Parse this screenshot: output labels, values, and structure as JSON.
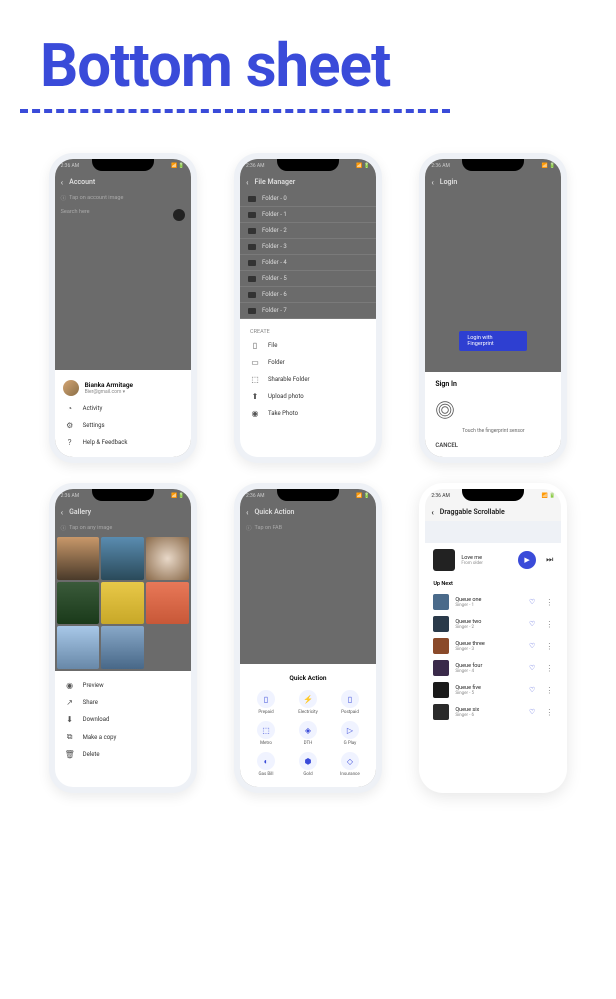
{
  "page": {
    "title": "Bottom sheet"
  },
  "status": {
    "time": "2:36 AM"
  },
  "p1": {
    "title": "Account",
    "hint": "Tap on account image",
    "search": "Search here",
    "user": {
      "name": "Bianka Armitage",
      "email": "Bier@gmail.com ▾"
    },
    "items": [
      "Activity",
      "Settings",
      "Help & Feedback"
    ]
  },
  "p2": {
    "title": "File Manager",
    "folders": [
      "Folder - 0",
      "Folder - 1",
      "Folder - 2",
      "Folder - 3",
      "Folder - 4",
      "Folder - 5",
      "Folder - 6",
      "Folder - 7"
    ],
    "create": "CREATE",
    "items": [
      "File",
      "Folder",
      "Sharable Folder",
      "Upload photo",
      "Take Photo"
    ]
  },
  "p3": {
    "title": "Login",
    "btn": "Login with Fingerprint",
    "signin": "Sign In",
    "touch": "Touch the fingerprint sensor",
    "cancel": "CANCEL"
  },
  "p4": {
    "title": "Gallery",
    "hint": "Tap on any image",
    "items": [
      "Preview",
      "Share",
      "Download",
      "Make a copy",
      "Delete"
    ]
  },
  "p5": {
    "title": "Quick Action",
    "hint": "Tap on FAB",
    "sheet_title": "Quick Action",
    "actions": [
      "Prepaid",
      "Electricity",
      "Postpaid",
      "Metro",
      "DTH",
      "G Play",
      "Gas Bill",
      "Gold",
      "Insurance"
    ]
  },
  "p6": {
    "title": "Draggable Scrollable",
    "now": {
      "title": "Love me",
      "sub": "From older"
    },
    "upnext": "Up Next",
    "queue": [
      {
        "t": "Queue one",
        "s": "Singer - 1"
      },
      {
        "t": "Queue two",
        "s": "Singer - 2"
      },
      {
        "t": "Queue three",
        "s": "Singer - 3"
      },
      {
        "t": "Queue four",
        "s": "Singer - 4"
      },
      {
        "t": "Queue five",
        "s": "Singer - 5"
      },
      {
        "t": "Queue six",
        "s": "Singer - 6"
      }
    ]
  }
}
